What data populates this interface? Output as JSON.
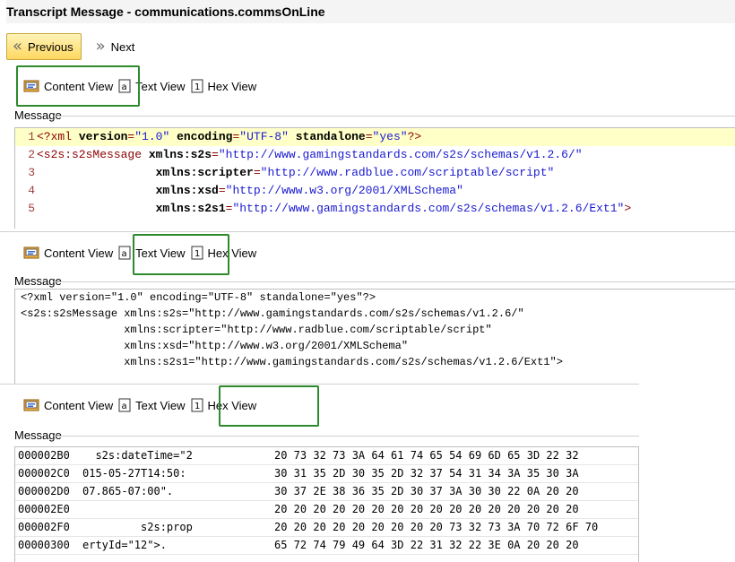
{
  "window": {
    "title": "Transcript Message - communications.commsOnLine"
  },
  "nav": {
    "previous_label": "Previous",
    "next_label": "Next"
  },
  "tabs": {
    "content": "Content View",
    "text": "Text View",
    "hex": "Hex View"
  },
  "message_label": "Message",
  "content_view": {
    "lines": [
      {
        "num": "1",
        "parts": [
          {
            "c": "tag",
            "t": "<?xml "
          },
          {
            "c": "attr",
            "t": "version"
          },
          {
            "c": "tag",
            "t": "="
          },
          {
            "c": "val",
            "t": "\"1.0\""
          },
          {
            "c": "tag",
            "t": " "
          },
          {
            "c": "attr",
            "t": "encoding"
          },
          {
            "c": "tag",
            "t": "="
          },
          {
            "c": "val",
            "t": "\"UTF-8\""
          },
          {
            "c": "tag",
            "t": " "
          },
          {
            "c": "attr",
            "t": "standalone"
          },
          {
            "c": "tag",
            "t": "="
          },
          {
            "c": "val",
            "t": "\"yes\""
          },
          {
            "c": "tag",
            "t": "?>"
          }
        ]
      },
      {
        "num": "2",
        "parts": [
          {
            "c": "tag",
            "t": "<s2s:s2sMessage "
          },
          {
            "c": "attr",
            "t": "xmlns:s2s"
          },
          {
            "c": "tag",
            "t": "="
          },
          {
            "c": "val",
            "t": "\"http://www.gamingstandards.com/s2s/schemas/v1.2.6/\""
          }
        ]
      },
      {
        "num": "3",
        "parts": [
          {
            "c": "tag",
            "t": "                 "
          },
          {
            "c": "attr",
            "t": "xmlns:scripter"
          },
          {
            "c": "tag",
            "t": "="
          },
          {
            "c": "val",
            "t": "\"http://www.radblue.com/scriptable/script\""
          }
        ]
      },
      {
        "num": "4",
        "parts": [
          {
            "c": "tag",
            "t": "                 "
          },
          {
            "c": "attr",
            "t": "xmlns:xsd"
          },
          {
            "c": "tag",
            "t": "="
          },
          {
            "c": "val",
            "t": "\"http://www.w3.org/2001/XMLSchema\""
          }
        ]
      },
      {
        "num": "5",
        "parts": [
          {
            "c": "tag",
            "t": "                 "
          },
          {
            "c": "attr",
            "t": "xmlns:s2s1"
          },
          {
            "c": "tag",
            "t": "="
          },
          {
            "c": "val",
            "t": "\"http://www.gamingstandards.com/s2s/schemas/v1.2.6/Ext1\""
          },
          {
            "c": "tag",
            "t": ">"
          }
        ]
      }
    ]
  },
  "text_view": {
    "lines": [
      "<?xml version=\"1.0\" encoding=\"UTF-8\" standalone=\"yes\"?>",
      "<s2s:s2sMessage xmlns:s2s=\"http://www.gamingstandards.com/s2s/schemas/v1.2.6/\"",
      "                xmlns:scripter=\"http://www.radblue.com/scriptable/script\"",
      "                xmlns:xsd=\"http://www.w3.org/2001/XMLSchema\"",
      "                xmlns:s2s1=\"http://www.gamingstandards.com/s2s/schemas/v1.2.6/Ext1\">"
    ]
  },
  "hex_view": {
    "rows": [
      {
        "offset": "000002B0",
        "text": "  s2s:dateTime=\"2",
        "hex": "20 73 32 73 3A 64 61 74 65 54 69 6D 65 3D 22 32"
      },
      {
        "offset": "000002C0",
        "text": "015-05-27T14:50:",
        "hex": "30 31 35 2D 30 35 2D 32 37 54 31 34 3A 35 30 3A"
      },
      {
        "offset": "000002D0",
        "text": "07.865-07:00\".",
        "hex": "30 37 2E 38 36 35 2D 30 37 3A 30 30 22 0A 20 20"
      },
      {
        "offset": "000002E0",
        "text": "",
        "hex": "20 20 20 20 20 20 20 20 20 20 20 20 20 20 20 20"
      },
      {
        "offset": "000002F0",
        "text": "         s2s:prop",
        "hex": "20 20 20 20 20 20 20 20 20 73 32 73 3A 70 72 6F 70"
      },
      {
        "offset": "00000300",
        "text": "ertyId=\"12\">.",
        "hex": "65 72 74 79 49 64 3D 22 31 32 22 3E 0A 20 20 20"
      }
    ]
  }
}
